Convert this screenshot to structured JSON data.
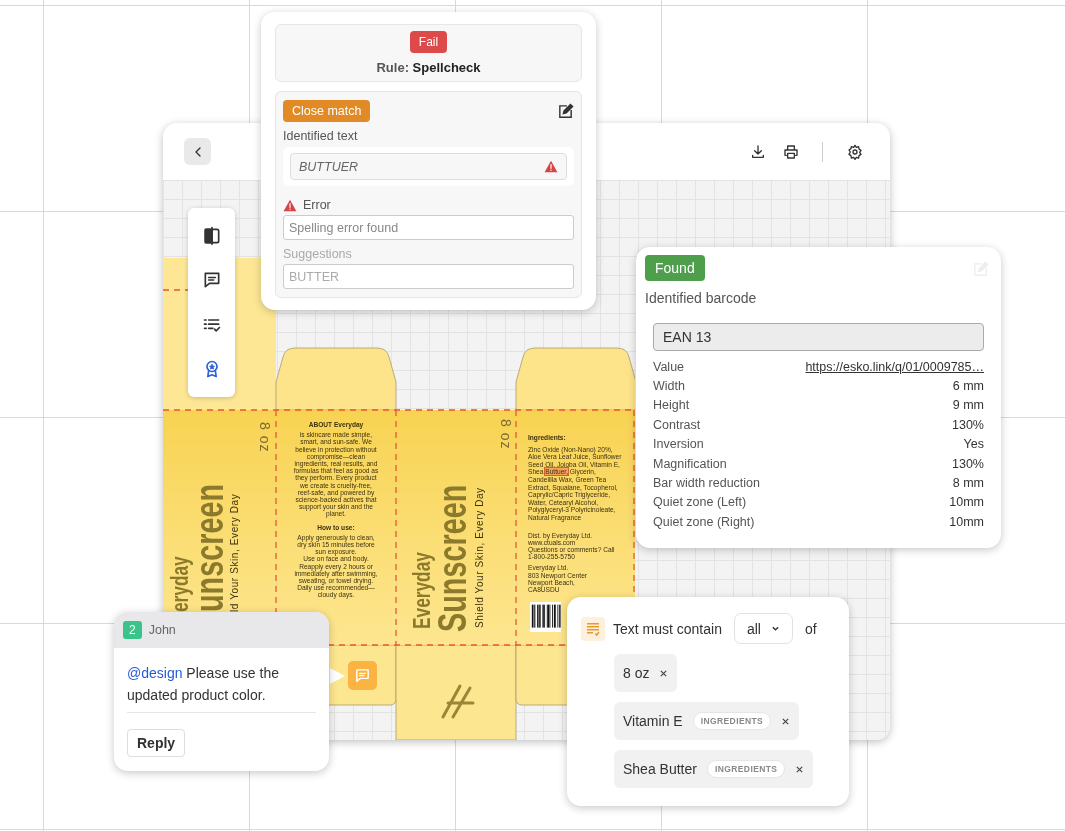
{
  "tools": [
    {
      "kind": "compare",
      "selected": false
    },
    {
      "kind": "comment",
      "selected": false
    },
    {
      "kind": "checklist",
      "selected": false
    },
    {
      "kind": "badge",
      "selected": true
    }
  ],
  "package": {
    "front_left": {
      "brand": "eryday",
      "product": "unscreen",
      "tagline": "ld Your Skin, Every Day",
      "size": "8 oz"
    },
    "about": {
      "title": "ABOUT Everyday",
      "body": "is skincare made simple,\nsmart, and sun-safe. We\nbelieve in protection without\ncompromise—clean\ningredients, real results, and\nformulas that feel as good as\nthey perform. Every product\nwe create is cruelty-free,\nreef-safe, and powered by\nscience-backed actives that\nsupport your skin and the\nplanet.",
      "howto_title": "How to use:",
      "howto": "Apply generously to clean,\ndry skin 15 minutes before\nsun exposure.\nUse on face and body.\nReapply every 2 hours or\nimmediately after swimming,\nsweating, or towel drying.\nDaily use recommended—\ncloudy days."
    },
    "front": {
      "brand": "Everyday",
      "product": "Sunscreen",
      "tagline": "Shield Your Skin, Every Day",
      "size": "8 oz"
    },
    "ingredients": {
      "title": "Ingredients:",
      "before": "Zinc Oxide (Non-Nano) 20%,\nAloe Vera Leaf Juice, Sunflower\nSeed Oil, Jojoba Oil, Vitamin E,\nShea ",
      "flagged": "Buttuer,",
      "after": " Glycerin,\nCandelilla Wax, Green Tea\nExtract, Squalane, Tocopherol,\nCaprylic/Capric Triglyceride,\nWater, Cetearyl Alcohol,\nPolyglyceryl-3 Polyricinoleate,\nNatural Fragrance",
      "distributor": "Dist. by Everyday Ltd.\nwww.ctuals.com\nQuestions or comments? Call\n1-800-255-5750",
      "address": "Everyday Ltd.\n803 Newport Center\nNewport Beach,\nCA8USDU"
    }
  },
  "spellcheck": {
    "status": "Fail",
    "rule_label": "Rule:",
    "rule": "Spellcheck",
    "match": "Close match",
    "identified_label": "Identified text",
    "identified": "BUTTUER",
    "error_label": "Error",
    "error": "Spelling error found",
    "suggestions_label": "Suggestions",
    "suggestion": "BUTTER"
  },
  "barcode": {
    "status": "Found",
    "title": "Identified barcode",
    "type": "EAN 13",
    "properties": [
      {
        "label": "Value",
        "value": "https://esko.link/q/01/0009785…",
        "kind": "link"
      },
      {
        "label": "Width",
        "value": "6 mm",
        "kind": "text"
      },
      {
        "label": "Height",
        "value": "9 mm",
        "kind": "text"
      },
      {
        "label": "Contrast",
        "value": "130%",
        "kind": "text"
      },
      {
        "label": "Inversion",
        "value": "Yes",
        "kind": "text"
      },
      {
        "label": "Magnification",
        "value": "130%",
        "kind": "text"
      },
      {
        "label": "Bar width reduction",
        "value": "8 mm",
        "kind": "text"
      },
      {
        "label": "Quiet zone (Left)",
        "value": "10mm",
        "kind": "text"
      },
      {
        "label": "Quiet zone (Right)",
        "value": "10mm",
        "kind": "text"
      }
    ]
  },
  "comment": {
    "count": "2",
    "author": "John",
    "mention": "@design",
    "text": "Please use the updated product color.",
    "reply": "Reply"
  },
  "text_rule": {
    "label": "Text must contain",
    "mode": "all",
    "suffix": "of",
    "terms": [
      {
        "text": "8 oz"
      },
      {
        "text": "Vitamin E",
        "tag": "INGREDIENTS"
      },
      {
        "text": "Shea Butter",
        "tag": "INGREDIENTS"
      }
    ]
  }
}
